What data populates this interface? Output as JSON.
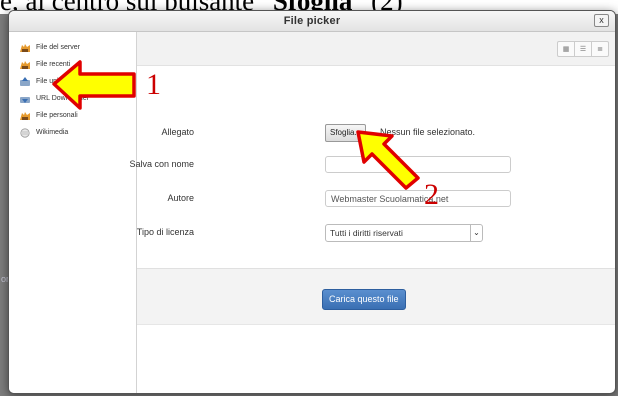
{
  "caption": {
    "prefix": "e, al centro sul pulsante “",
    "bold": "Sfoglia",
    "suffix": "” (2)"
  },
  "dialog": {
    "title": "File picker",
    "close": "x"
  },
  "sidebar": {
    "items": [
      {
        "label": "File del server",
        "icon": "folder-icon"
      },
      {
        "label": "File recenti",
        "icon": "folder-icon"
      },
      {
        "label": "File upload",
        "icon": "upload-icon"
      },
      {
        "label": "URL Downloader",
        "icon": "url-download-icon"
      },
      {
        "label": "File personali",
        "icon": "folder-icon"
      },
      {
        "label": "Wikimedia",
        "icon": "wikimedia-icon"
      }
    ]
  },
  "toolbar": {
    "views": [
      "grid-view-icon",
      "list-view-icon",
      "tree-view-icon"
    ]
  },
  "form": {
    "attachment_label": "Allegato",
    "browse_label": "Sfoglia...",
    "no_file_text": "Nessun file selezionato.",
    "save_as_label": "Salva con nome",
    "save_as_value": "",
    "author_label": "Autore",
    "author_value": "Webmaster Scuolamatica.net",
    "license_label": "Tipo di licenza",
    "license_value": "Tutti i diritti riservati"
  },
  "upload_button": "Carica questo file",
  "annotations": {
    "step1": "1",
    "step2": "2",
    "arrow_color": "#ffff00",
    "arrow_outline": "#e00000"
  },
  "background_hint": "or"
}
